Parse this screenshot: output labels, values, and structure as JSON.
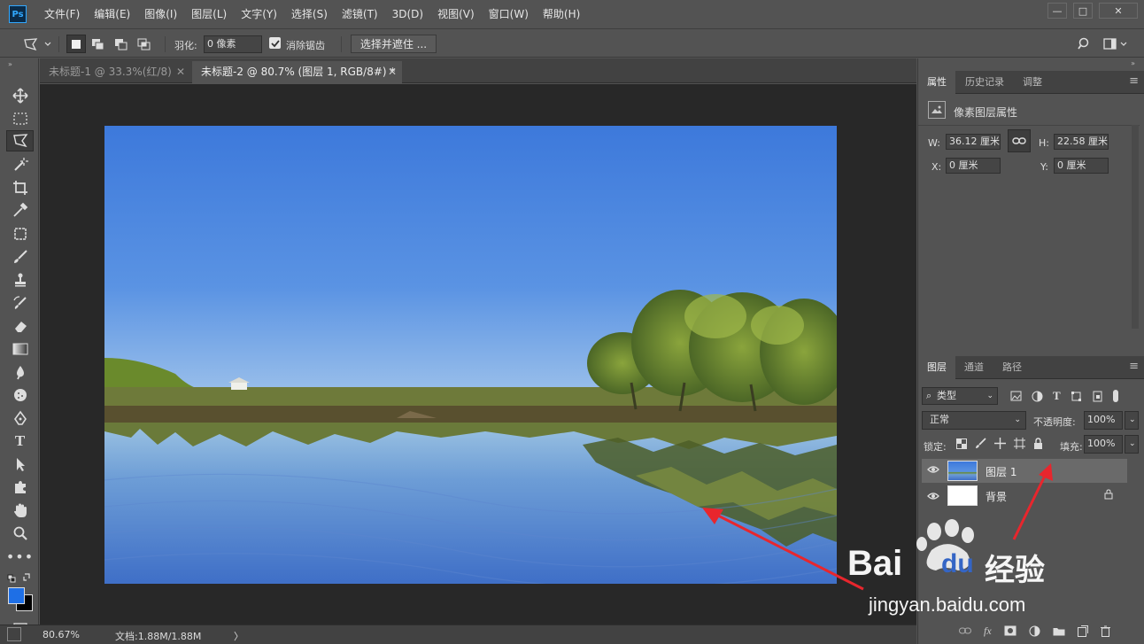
{
  "app": {
    "logo": "Ps"
  },
  "menu": [
    "文件(F)",
    "编辑(E)",
    "图像(I)",
    "图层(L)",
    "文字(Y)",
    "选择(S)",
    "滤镜(T)",
    "3D(D)",
    "视图(V)",
    "窗口(W)",
    "帮助(H)"
  ],
  "window_controls": {
    "minimize": "—",
    "restore": "□",
    "close": "✕"
  },
  "options": {
    "feather_label": "羽化:",
    "feather_value": "0 像素",
    "antialias_label": "消除锯齿",
    "antialias_checked": true,
    "select_mask_button": "选择并遮住 ..."
  },
  "doc_tabs": [
    {
      "label": "未标题-1 @ 33.3%(红/8)",
      "active": false
    },
    {
      "label": "未标题-2 @ 80.7% (图层 1, RGB/8#) *",
      "active": true
    }
  ],
  "status": {
    "zoom": "80.67%",
    "doc": "文档:1.88M/1.88M",
    "arrow": "〉"
  },
  "properties_panel": {
    "tabs": [
      "属性",
      "历史记录",
      "调整"
    ],
    "title": "像素图层属性",
    "w_label": "W:",
    "w_value": "36.12 厘米",
    "h_label": "H:",
    "h_value": "22.58 厘米",
    "x_label": "X:",
    "x_value": "0 厘米",
    "y_label": "Y:",
    "y_value": "0 厘米"
  },
  "layers_panel": {
    "tabs": [
      "图层",
      "通道",
      "路径"
    ],
    "filter_kind": "类型",
    "blend_mode": "正常",
    "opacity_label": "不透明度:",
    "opacity_value": "100%",
    "lock_label": "锁定:",
    "fill_label": "填充:",
    "fill_value": "100%",
    "layers": [
      {
        "name": "图层 1",
        "selected": true,
        "visible": true,
        "locked": false
      },
      {
        "name": "背景",
        "selected": false,
        "visible": true,
        "locked": true
      }
    ]
  },
  "watermark": {
    "brand": "Bai",
    "brand2": "du",
    "product": "经验",
    "url": "jingyan.baidu.com"
  },
  "colors": {
    "accent": "#31a8ff",
    "foreground": "#1e6fe6",
    "background": "#000000",
    "annotation_arrow": "#e8262d"
  }
}
